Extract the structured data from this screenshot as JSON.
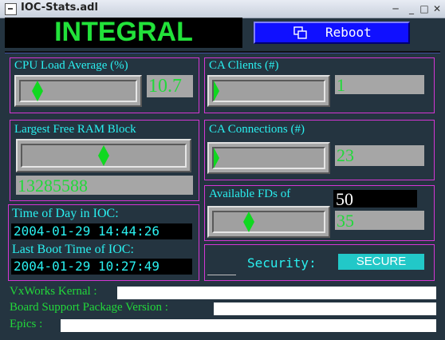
{
  "window": {
    "title": "IOC-Stats.adl"
  },
  "header": {
    "title": "INTEGRAL",
    "reboot_label": "Reboot"
  },
  "cpu": {
    "label": "CPU Load Average (%)",
    "value": "10.7",
    "fraction": 0.107
  },
  "ram": {
    "label": "Largest Free RAM Block",
    "value": "13285588",
    "fraction": 0.5
  },
  "ca_clients": {
    "label": "CA Clients (#)",
    "value": "1",
    "fraction": 0.0
  },
  "ca_connections": {
    "label": "CA Connections (#)",
    "value": "23",
    "fraction": 0.0
  },
  "fds": {
    "label": "Available FDs of",
    "total": "50",
    "value": "35",
    "fraction": 0.3
  },
  "time": {
    "tod_label": "Time of Day in IOC:",
    "tod_value": "2004-01-29 14:44:26",
    "boot_label": "Last Boot Time of IOC:",
    "boot_value": "2004-01-29 10:27:49"
  },
  "security": {
    "label": "Security:",
    "status": "SECURE",
    "input_value": ""
  },
  "info": {
    "vxworks_label": "VxWorks Kernal :",
    "vxworks_value": "",
    "bsp_label": "Board Support Package Version :",
    "bsp_value": "",
    "epics_label": "Epics :",
    "epics_value": ""
  },
  "colors": {
    "label": "#2af0f0",
    "value": "#22d83a",
    "frame": "#d436d4",
    "background": "#243440",
    "reboot": "#1010ff"
  }
}
